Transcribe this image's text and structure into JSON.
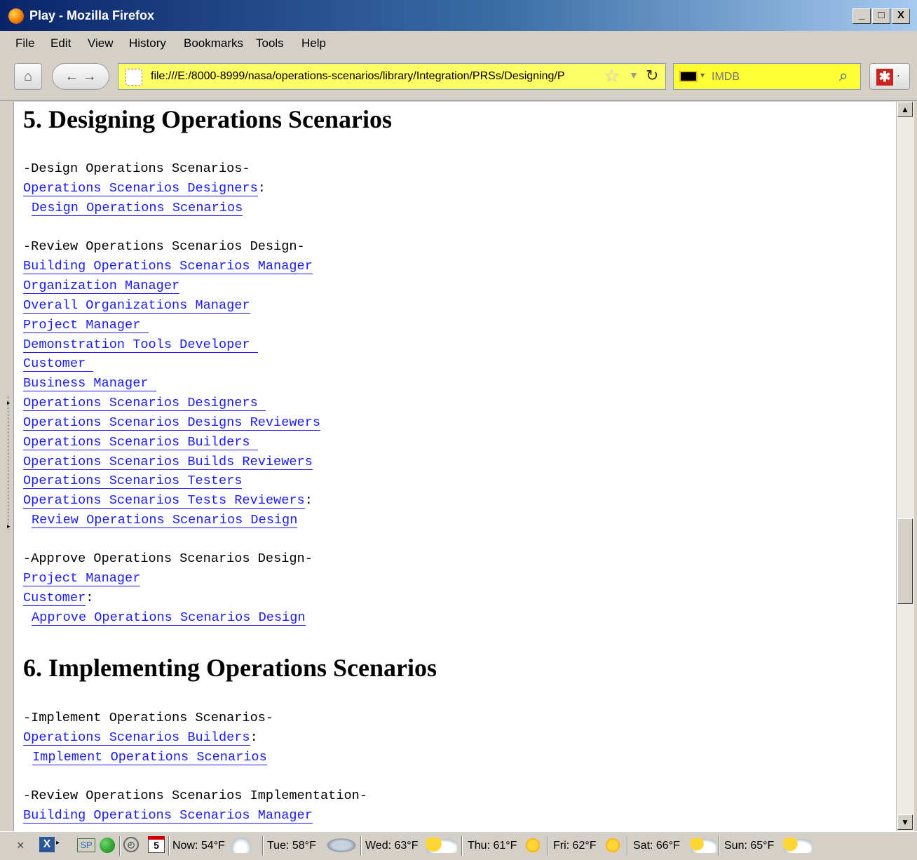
{
  "window": {
    "title": "Play - Mozilla Firefox",
    "buttons": [
      "_",
      "□",
      "X"
    ]
  },
  "menu": [
    "File",
    "Edit",
    "View",
    "History",
    "Bookmarks",
    "Tools",
    "Help"
  ],
  "nav": {
    "url": "file:///E:/8000-8999/nasa/operations-scenarios/library/Integration/PRSs/Designing/P",
    "search_placeholder": "IMDB"
  },
  "content": {
    "h5": "5. Designing Operations Scenarios",
    "s5_1_title": "-Design Operations Scenarios-",
    "s5_1_roles": [
      "Operations Scenarios Designers"
    ],
    "s5_1_action": "Design Operations Scenarios",
    "s5_2_title": "-Review Operations Scenarios Design-",
    "s5_2_roles": [
      "Building Operations Scenarios Manager",
      "Organization Manager",
      "Overall Organizations Manager",
      "Project Manager ",
      "Demonstration Tools Developer ",
      "Customer ",
      "Business Manager ",
      "Operations Scenarios Designers ",
      "Operations Scenarios Designs Reviewers",
      "Operations Scenarios Builders ",
      "Operations Scenarios Builds Reviewers",
      "Operations Scenarios Testers",
      "Operations Scenarios Tests Reviewers"
    ],
    "s5_2_action": "Review Operations Scenarios Design",
    "s5_3_title": "-Approve Operations Scenarios Design-",
    "s5_3_roles": [
      "Project Manager",
      "Customer"
    ],
    "s5_3_action": "Approve Operations Scenarios Design",
    "h6": "6. Implementing Operations Scenarios",
    "s6_1_title": "-Implement Operations Scenarios-",
    "s6_1_roles": [
      "Operations Scenarios Builders"
    ],
    "s6_1_action": "Implement Operations Scenarios",
    "s6_2_title": "-Review Operations Scenarios Implementation-",
    "s6_2_roles": [
      "Building Operations Scenarios Manager"
    ]
  },
  "status": {
    "close": "×",
    "sp": "SP",
    "calendar_day": "5",
    "weather": [
      "Now: 54°F",
      "Tue: 58°F",
      "Wed: 63°F",
      "Thu: 61°F",
      "Fri: 62°F",
      "Sat: 66°F",
      "Sun: 65°F"
    ]
  }
}
